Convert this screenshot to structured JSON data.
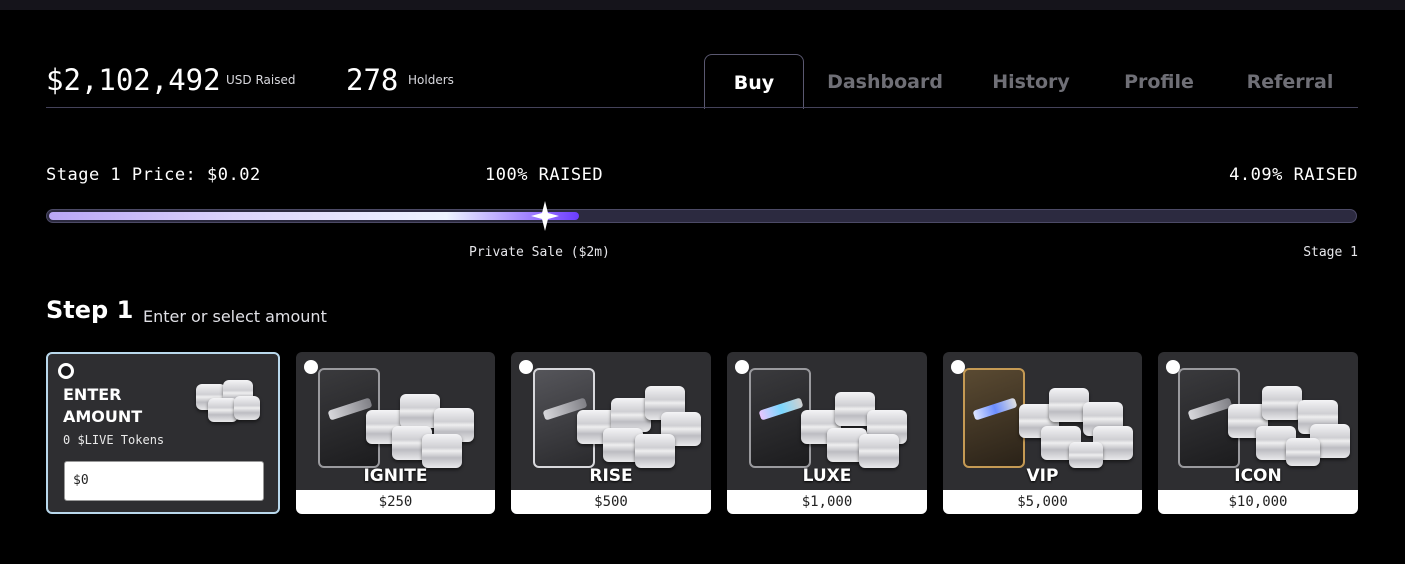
{
  "stats": {
    "usd_raised_value": "$2,102,492",
    "usd_raised_label": "USD Raised",
    "holders_value": "278",
    "holders_label": "Holders"
  },
  "tabs": [
    {
      "label": "Buy",
      "active": true
    },
    {
      "label": "Dashboard",
      "active": false
    },
    {
      "label": "History",
      "active": false
    },
    {
      "label": "Profile",
      "active": false
    },
    {
      "label": "Referral",
      "active": false
    }
  ],
  "progress": {
    "price_text": "Stage 1 Price: $0.02",
    "left_raised": "100% RAISED",
    "right_raised": "4.09% RAISED",
    "private_sale_label": "Private Sale ($2m)",
    "stage_label": "Stage 1",
    "private_sale_raised_pct": 100,
    "stage1_raised_pct": 4.09
  },
  "step": {
    "title": "Step 1",
    "subtitle": "Enter or select amount"
  },
  "enter_amount": {
    "title": "ENTER AMOUNT",
    "tokens_text": "0 $LIVE Tokens",
    "input_value": "$0",
    "selected": true
  },
  "packages": [
    {
      "name": "IGNITE",
      "price": "$250",
      "selected": false
    },
    {
      "name": "RISE",
      "price": "$500",
      "selected": false
    },
    {
      "name": "LUXE",
      "price": "$1,000",
      "selected": false
    },
    {
      "name": "VIP",
      "price": "$5,000",
      "selected": false
    },
    {
      "name": "ICON",
      "price": "$10,000",
      "selected": false
    }
  ],
  "colors": {
    "background": "#000000",
    "card": "#2e2e31",
    "accent": "#8a61ff",
    "selected_border": "#b9d8ec",
    "tab_inactive": "#6f6f76"
  }
}
